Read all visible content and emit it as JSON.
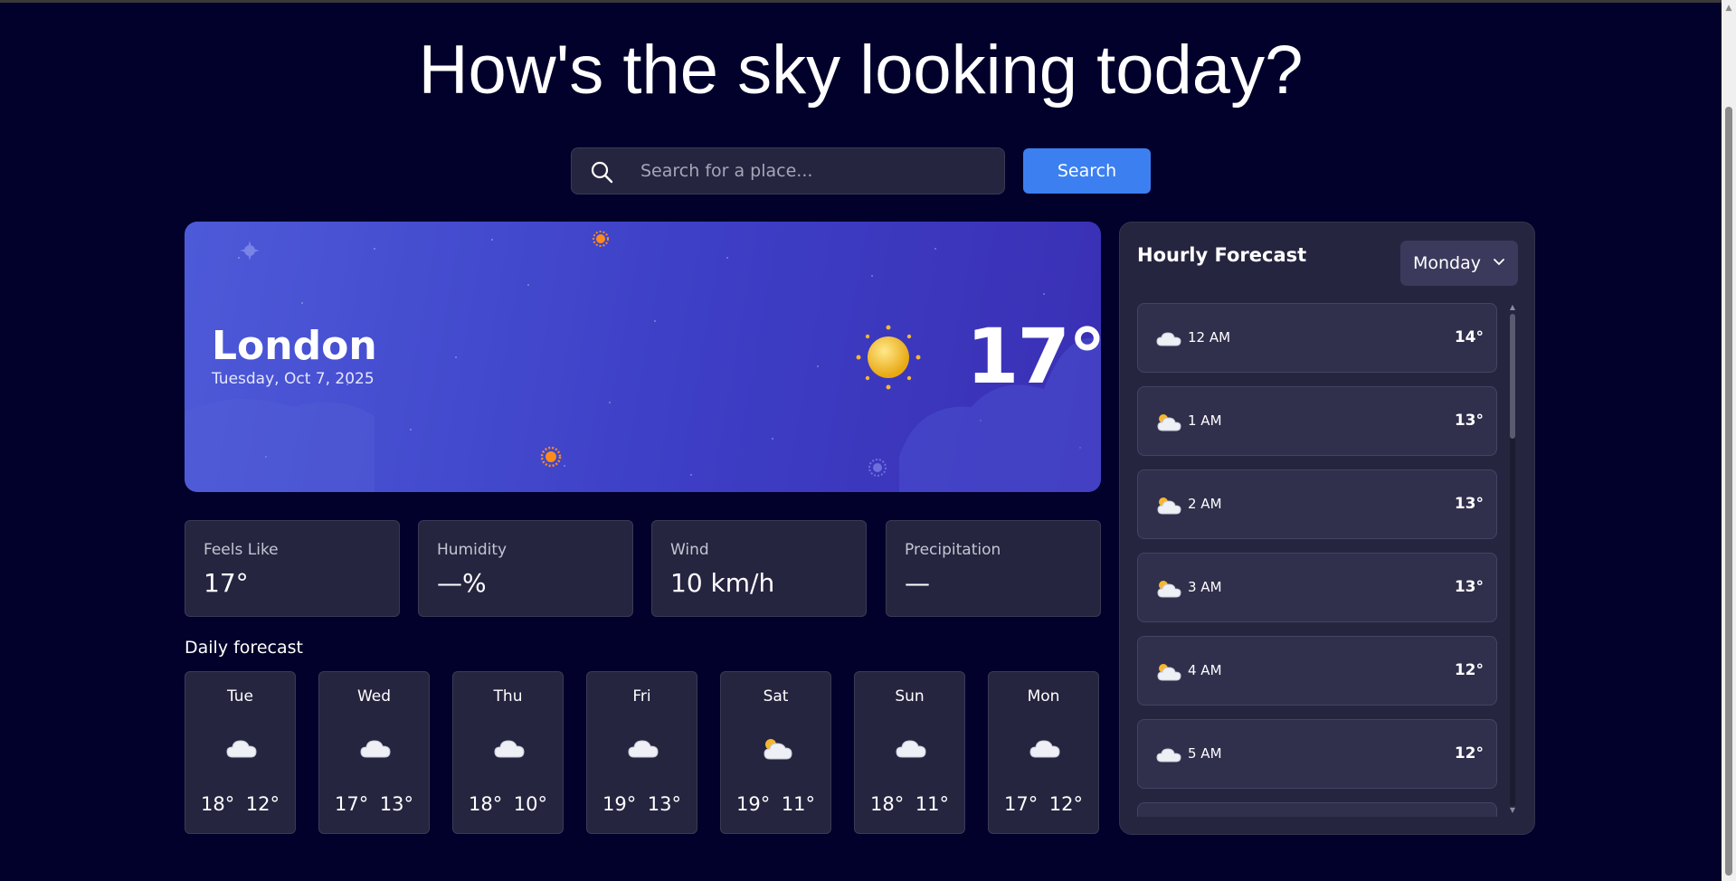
{
  "title": "How's the sky looking today?",
  "search": {
    "placeholder": "Search for a place...",
    "button_label": "Search"
  },
  "current": {
    "city": "London",
    "date": "Tuesday, Oct 7, 2025",
    "temperature": "17°",
    "icon": "sun-icon"
  },
  "stats": [
    {
      "label": "Feels Like",
      "value": "17°"
    },
    {
      "label": "Humidity",
      "value": "—%"
    },
    {
      "label": "Wind",
      "value": "10 km/h"
    },
    {
      "label": "Precipitation",
      "value": "—"
    }
  ],
  "daily": {
    "title": "Daily forecast",
    "days": [
      {
        "name": "Tue",
        "icon": "cloud-icon",
        "hi": "18°",
        "lo": "12°"
      },
      {
        "name": "Wed",
        "icon": "cloud-icon",
        "hi": "17°",
        "lo": "13°"
      },
      {
        "name": "Thu",
        "icon": "cloud-icon",
        "hi": "18°",
        "lo": "10°"
      },
      {
        "name": "Fri",
        "icon": "cloud-icon",
        "hi": "19°",
        "lo": "13°"
      },
      {
        "name": "Sat",
        "icon": "partly-cloudy-icon",
        "hi": "19°",
        "lo": "11°"
      },
      {
        "name": "Sun",
        "icon": "cloud-icon",
        "hi": "18°",
        "lo": "11°"
      },
      {
        "name": "Mon",
        "icon": "cloud-icon",
        "hi": "17°",
        "lo": "12°"
      }
    ]
  },
  "hourly": {
    "title": "Hourly Forecast",
    "selected_day": "Monday",
    "hours": [
      {
        "time": "12 AM",
        "icon": "cloud-icon",
        "temp": "14°"
      },
      {
        "time": "1 AM",
        "icon": "partly-cloudy-icon",
        "temp": "13°"
      },
      {
        "time": "2 AM",
        "icon": "partly-cloudy-icon",
        "temp": "13°"
      },
      {
        "time": "3 AM",
        "icon": "partly-cloudy-icon",
        "temp": "13°"
      },
      {
        "time": "4 AM",
        "icon": "partly-cloudy-icon",
        "temp": "12°"
      },
      {
        "time": "5 AM",
        "icon": "cloud-icon",
        "temp": "12°"
      }
    ]
  },
  "colors": {
    "background": "#02012b",
    "card": "#262540",
    "accent": "#3c7ff0",
    "hero_start": "#4d5ad8",
    "hero_end": "#3a2fb4"
  }
}
